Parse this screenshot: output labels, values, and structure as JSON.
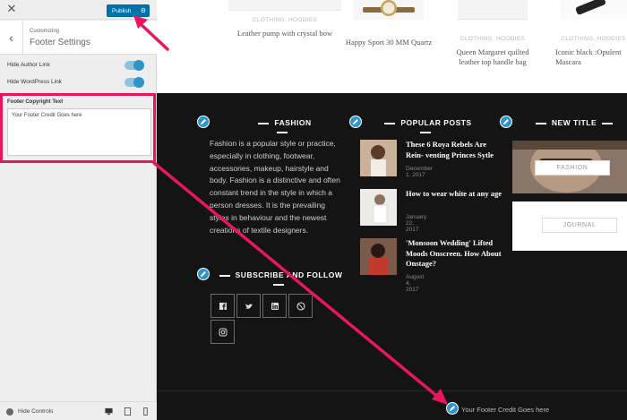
{
  "sidebar": {
    "publish_label": "Publish",
    "breadcrumb": "Customizing",
    "section_title": "Footer Settings",
    "toggles": [
      {
        "label": "Hide Author Link",
        "on": true
      },
      {
        "label": "Hide WordPress Link",
        "on": true
      }
    ],
    "copyright": {
      "label": "Footer Copyright Text",
      "value": "Your Footer Credit Goes here"
    },
    "hide_controls_label": "Hide Controls"
  },
  "preview": {
    "products": [
      {
        "category": "CLOTHING, HOODIES",
        "name": "Leather pump with crystal bow"
      },
      {
        "category": "",
        "name": "Happy Sport 30 MM Quartz"
      },
      {
        "category": "CLOTHING, HOODIES",
        "name": "Queen Margaret quilted leather top handle bag"
      },
      {
        "category": "CLOTHING, HOODIES",
        "name": "Iconic black :Opulent Mascara"
      }
    ],
    "footer": {
      "fashion": {
        "title": "FASHION",
        "text": "Fashion is a popular style or practice, especially in clothing, footwear, accessories, makeup, hairstyle and body. Fashion is a distinctive and often constant trend in the style in which a person dresses. It is the prevailing styles in behaviour and the newest creations of textile designers."
      },
      "popular_posts": {
        "title": "POPULAR POSTS",
        "posts": [
          {
            "title": "These 6 Roya Rebels Are Rein- venting Princes Sytle",
            "date": "December 1, 2017"
          },
          {
            "title": "How to wear white at any age",
            "date": "January 22, 2017"
          },
          {
            "title": "'Monsoon Wedding' Lifted Moods Onscreen. How About Onstage?",
            "date": "August 4, 2017"
          }
        ]
      },
      "new_title": {
        "title": "NEW TITLE",
        "buttons": [
          "FASHION",
          "JOURNAL"
        ]
      },
      "subscribe": {
        "title": "SUBSCRIBE AND FOLLOW",
        "icons": [
          "facebook-icon",
          "twitter-icon",
          "linkedin-icon",
          "dribbble-icon",
          "instagram-icon"
        ]
      },
      "credit_text": "Your Footer Credit Goes here"
    }
  },
  "colors": {
    "accent": "#2e93c9",
    "publish": "#0073aa",
    "highlight": "#e8175d",
    "footer_bg": "#141414"
  }
}
